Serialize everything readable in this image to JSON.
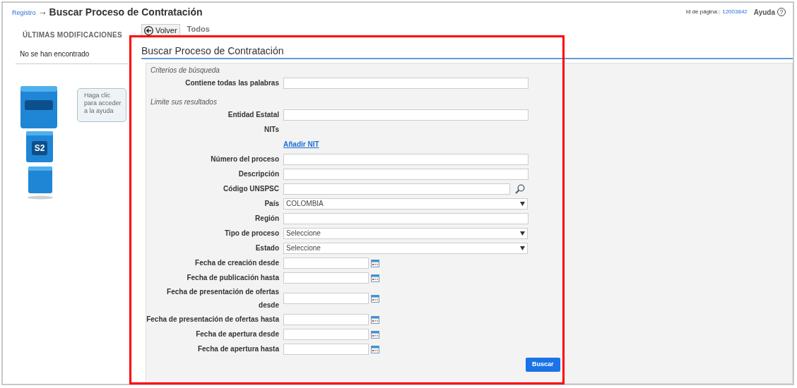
{
  "breadcrumb": {
    "link": "Registro",
    "separator": "→",
    "title": "Buscar Proceso de Contratación"
  },
  "page_id": {
    "label": "Id de página::",
    "value": "12003842"
  },
  "help": {
    "label": "Ayuda",
    "icon": "?"
  },
  "sidebar": {
    "heading": "ÚLTIMAS MODIFICACIONES",
    "empty_text": "No se han encontrado",
    "help_bubble": [
      "Haga clic",
      "para acceder",
      "a la ayuda"
    ],
    "mascot_badge": "S2"
  },
  "back_button": "Volver",
  "tabs": [
    {
      "label": "Todos",
      "selected": true
    }
  ],
  "panel_title": "Buscar Proceso de Contratación",
  "form": {
    "sections": [
      {
        "heading": "Criterios de búsqueda",
        "fields": [
          {
            "kind": "text",
            "label": "Contiene todas las palabras"
          }
        ]
      },
      {
        "heading": "Limite sus resultados",
        "fields": [
          {
            "kind": "text",
            "label": "Entidad Estatal"
          },
          {
            "kind": "label",
            "label": "NITs"
          },
          {
            "kind": "link",
            "text": "Añadir NIT"
          },
          {
            "kind": "text",
            "label": "Número del proceso"
          },
          {
            "kind": "text",
            "label": "Descripción"
          },
          {
            "kind": "lookup",
            "label": "Código UNSPSC"
          },
          {
            "kind": "select",
            "label": "País",
            "value": "COLOMBIA"
          },
          {
            "kind": "text",
            "label": "Región"
          },
          {
            "kind": "select",
            "label": "Tipo de proceso",
            "value": "Seleccione"
          },
          {
            "kind": "select",
            "label": "Estado",
            "value": "Seleccione"
          },
          {
            "kind": "date",
            "label": "Fecha de creación desde"
          },
          {
            "kind": "date",
            "label": "Fecha de publicación hasta"
          },
          {
            "kind": "date",
            "label": "Fecha de presentación de ofertas desde"
          },
          {
            "kind": "date",
            "label": "Fecha de presentación de ofertas hasta"
          },
          {
            "kind": "date",
            "label": "Fecha de apertura desde"
          },
          {
            "kind": "date",
            "label": "Fecha de apertura hasta"
          }
        ]
      }
    ]
  },
  "search_button": "Buscar",
  "annotation": {
    "highlight_frame": true
  }
}
